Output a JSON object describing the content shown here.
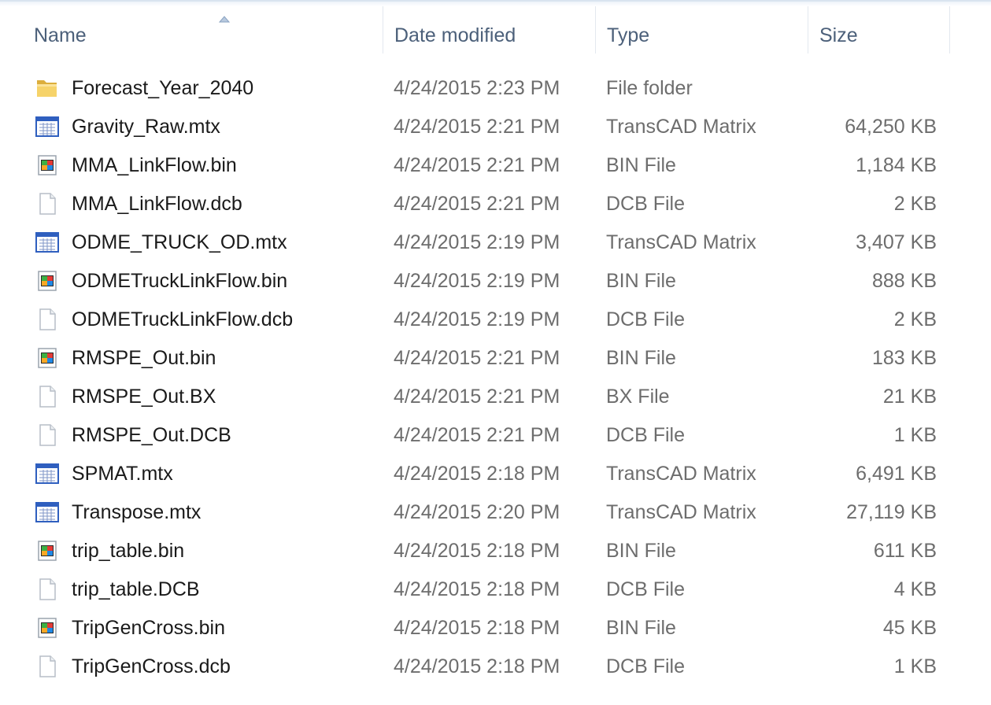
{
  "columns": {
    "name": "Name",
    "date_modified": "Date modified",
    "type": "Type",
    "size": "Size"
  },
  "files": [
    {
      "name": "Forecast_Year_2040",
      "date": "4/24/2015 2:23 PM",
      "type": "File folder",
      "size": "",
      "icon": "folder-icon"
    },
    {
      "name": "Gravity_Raw.mtx",
      "date": "4/24/2015 2:21 PM",
      "type": "TransCAD Matrix",
      "size": "64,250 KB",
      "icon": "matrix-file-icon"
    },
    {
      "name": "MMA_LinkFlow.bin",
      "date": "4/24/2015 2:21 PM",
      "type": "BIN File",
      "size": "1,184 KB",
      "icon": "bin-file-icon"
    },
    {
      "name": "MMA_LinkFlow.dcb",
      "date": "4/24/2015 2:21 PM",
      "type": "DCB File",
      "size": "2 KB",
      "icon": "blank-file-icon"
    },
    {
      "name": "ODME_TRUCK_OD.mtx",
      "date": "4/24/2015 2:19 PM",
      "type": "TransCAD Matrix",
      "size": "3,407 KB",
      "icon": "matrix-file-icon"
    },
    {
      "name": "ODMETruckLinkFlow.bin",
      "date": "4/24/2015 2:19 PM",
      "type": "BIN File",
      "size": "888 KB",
      "icon": "bin-file-icon"
    },
    {
      "name": "ODMETruckLinkFlow.dcb",
      "date": "4/24/2015 2:19 PM",
      "type": "DCB File",
      "size": "2 KB",
      "icon": "blank-file-icon"
    },
    {
      "name": "RMSPE_Out.bin",
      "date": "4/24/2015 2:21 PM",
      "type": "BIN File",
      "size": "183 KB",
      "icon": "bin-file-icon"
    },
    {
      "name": "RMSPE_Out.BX",
      "date": "4/24/2015 2:21 PM",
      "type": "BX File",
      "size": "21 KB",
      "icon": "blank-file-icon"
    },
    {
      "name": "RMSPE_Out.DCB",
      "date": "4/24/2015 2:21 PM",
      "type": "DCB File",
      "size": "1 KB",
      "icon": "blank-file-icon"
    },
    {
      "name": "SPMAT.mtx",
      "date": "4/24/2015 2:18 PM",
      "type": "TransCAD Matrix",
      "size": "6,491 KB",
      "icon": "matrix-file-icon"
    },
    {
      "name": "Transpose.mtx",
      "date": "4/24/2015 2:20 PM",
      "type": "TransCAD Matrix",
      "size": "27,119 KB",
      "icon": "matrix-file-icon"
    },
    {
      "name": "trip_table.bin",
      "date": "4/24/2015 2:18 PM",
      "type": "BIN File",
      "size": "611 KB",
      "icon": "bin-file-icon"
    },
    {
      "name": "trip_table.DCB",
      "date": "4/24/2015 2:18 PM",
      "type": "DCB File",
      "size": "4 KB",
      "icon": "blank-file-icon"
    },
    {
      "name": "TripGenCross.bin",
      "date": "4/24/2015 2:18 PM",
      "type": "BIN File",
      "size": "45 KB",
      "icon": "bin-file-icon"
    },
    {
      "name": "TripGenCross.dcb",
      "date": "4/24/2015 2:18 PM",
      "type": "DCB File",
      "size": "1 KB",
      "icon": "blank-file-icon"
    }
  ],
  "colors": {
    "header_text": "#4c607a",
    "name_text": "#1a1a1a",
    "detail_text": "#6d6d6d",
    "matrix_icon_blue": "#2f5fbf",
    "folder_yellow": "#f2c94c"
  }
}
